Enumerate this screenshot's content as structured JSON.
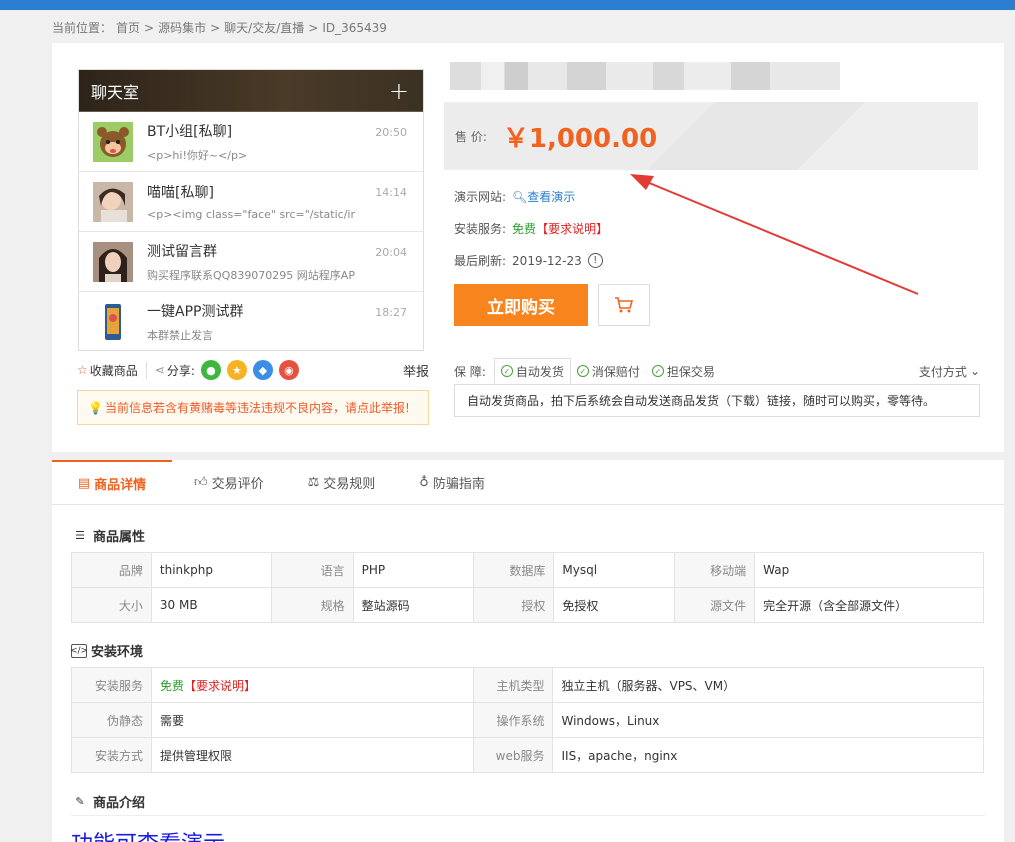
{
  "breadcrumb": {
    "label": "当前位置：",
    "items": [
      "首页",
      ">",
      "源码集市",
      ">",
      "聊天/交友/直播",
      ">",
      "ID_365439"
    ]
  },
  "phone": {
    "title": "聊天室",
    "plus": "+",
    "chats": [
      {
        "name": "BT小组[私聊]",
        "msg": "<p>hi!你好~</p>",
        "time": "20:50",
        "avatar_color": "#d88a4a"
      },
      {
        "name": "喵喵[私聊]",
        "msg": "<p><img class=\"face\" src=\"/static/ir",
        "time": "14:14",
        "avatar_color": "#b8a090"
      },
      {
        "name": "测试留言群",
        "msg": "购买程序联系QQ839070295 网站程序AP",
        "time": "20:04",
        "avatar_color": "#8a7060"
      },
      {
        "name": "一键APP测试群",
        "msg": "本群禁止发言",
        "time": "18:27",
        "avatar_color": "#3a6ea8"
      }
    ]
  },
  "actions": {
    "favorite": "收藏商品",
    "share": "分享:",
    "report": "举报"
  },
  "warning": "当前信息若含有黄赌毒等违法违规不良内容，请点此举报!",
  "price": {
    "label": "售 价:",
    "value": "￥1,000.00"
  },
  "info": {
    "demo_label": "演示网站:",
    "demo_value": "查看演示",
    "install_label": "安装服务:",
    "install_free": "免费",
    "install_req": "【要求说明】",
    "refresh_label": "最后刷新:",
    "refresh_value": "2019-12-23",
    "info_icon": "!"
  },
  "buy": {
    "label": "立即购买"
  },
  "guarantee": {
    "label": "保 障:",
    "tabs": [
      "自动发货",
      "消保赔付",
      "担保交易"
    ],
    "paymethod": "支付方式",
    "desc": "自动发货商品，拍下后系统会自动发送商品发货（下载）链接，随时可以购买，零等待。"
  },
  "tabs": [
    "商品详情",
    "交易评价",
    "交易规则",
    "防骗指南"
  ],
  "attrs": {
    "title": "商品属性",
    "rows": [
      [
        "品牌",
        "thinkphp",
        "语言",
        "PHP",
        "数据库",
        "Mysql",
        "移动端",
        "Wap"
      ],
      [
        "大小",
        "30 MB",
        "规格",
        "整站源码",
        "授权",
        "免授权",
        "源文件",
        "完全开源（含全部源文件）"
      ]
    ]
  },
  "env": {
    "title": "安装环境",
    "rows": [
      {
        "k1": "安装服务",
        "v1_free": "免费",
        "v1_req": "【要求说明】",
        "k2": "主机类型",
        "v2": "独立主机（服务器、VPS、VM）"
      },
      {
        "k1": "伪静态",
        "v1": "需要",
        "k2": "操作系统",
        "v2": "Windows，Linux"
      },
      {
        "k1": "安装方式",
        "v1": "提供管理权限",
        "k2": "web服务",
        "v2": "IIS，apache，nginx"
      }
    ]
  },
  "intro": {
    "title": "商品介绍",
    "headline": "功能可查看演示"
  }
}
